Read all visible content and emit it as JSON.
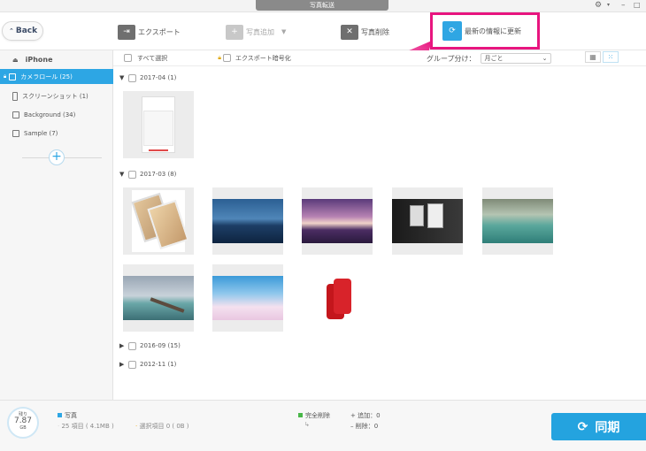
{
  "titlebar": {
    "title": "写真転送"
  },
  "toolbar": {
    "back_label": "Back",
    "export_label": "エクスポート",
    "add_photo_label": "写真追加",
    "delete_label": "写真削除",
    "refresh_label": "最新の情報に更新"
  },
  "sidebar": {
    "device": "iPhone",
    "items": [
      {
        "label": "カメラロール (25)"
      },
      {
        "label": "スクリーンショット (1)"
      },
      {
        "label": "Background (34)"
      },
      {
        "label": "Sample (7)"
      }
    ]
  },
  "content": {
    "select_all": "すべて選択",
    "export_encrypt": "エクスポート暗号化",
    "group_by_label": "グループ分け：",
    "group_by_value": "月ごと",
    "groups": [
      {
        "label": "2017-04 (1)",
        "expanded": true
      },
      {
        "label": "2017-03 (8)",
        "expanded": true
      },
      {
        "label": "2016-09 (15)",
        "expanded": false
      },
      {
        "label": "2012-11 (1)",
        "expanded": false
      }
    ]
  },
  "bottombar": {
    "gauge_label": "残り",
    "gauge_value": "7.87",
    "gauge_unit": "GB",
    "photos_label": "写真",
    "photos_count": "25 項目 ( 4.1MB )",
    "selected": "選択項目 0 ( 0B )",
    "permanent_delete": "完全削除",
    "added": "追加：0",
    "deleted": "削除：0",
    "sync_label": "同期"
  },
  "colors": {
    "accent": "#2da6e4",
    "highlight": "#e8157f"
  }
}
